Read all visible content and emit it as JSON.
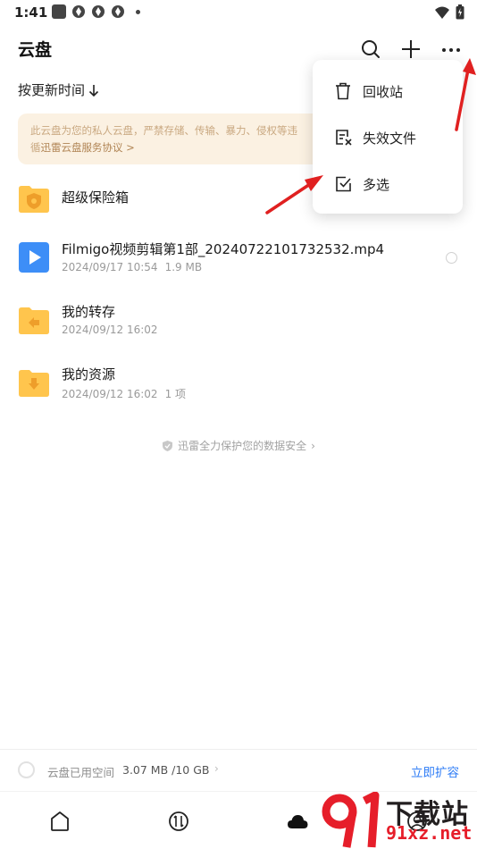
{
  "status_bar": {
    "time": "1:41"
  },
  "header": {
    "title": "云盘"
  },
  "sort": {
    "label": "按更新时间"
  },
  "notice": {
    "text": "此云盘为您的私人云盘，严禁存储、传输、暴力、侵权等违",
    "text_line2": "循",
    "link": "迅雷云盘服务协议 >"
  },
  "files": [
    {
      "name": "超级保险箱",
      "meta_date": "",
      "meta_extra": "",
      "icon": "safe-folder-icon"
    },
    {
      "name": "Filmigo视频剪辑第1部_20240722101732532.mp4",
      "meta_date": "2024/09/17 10:54",
      "meta_extra": "1.9 MB",
      "icon": "video-file-icon"
    },
    {
      "name": "我的转存",
      "meta_date": "2024/09/12 16:02",
      "meta_extra": "",
      "icon": "transfer-folder-icon"
    },
    {
      "name": "我的资源",
      "meta_date": "2024/09/12 16:02",
      "meta_extra": "1 项",
      "icon": "download-folder-icon"
    }
  ],
  "security_note": "迅雷全力保护您的数据安全",
  "menu": {
    "items": [
      {
        "label": "回收站",
        "icon": "trash-icon"
      },
      {
        "label": "失效文件",
        "icon": "invalid-file-icon"
      },
      {
        "label": "多选",
        "icon": "multi-select-icon"
      }
    ]
  },
  "storage": {
    "label": "云盘已用空间",
    "value": "3.07 MB /10 GB",
    "used_fraction": 0.0003,
    "expand": "立即扩容"
  },
  "watermark": {
    "big": "下载站",
    "small": "91xz.net"
  },
  "colors": {
    "accent": "#2f7df6",
    "folder": "#ffc54d",
    "arrow": "#e02020",
    "notice_bg": "#fbf1e2"
  }
}
